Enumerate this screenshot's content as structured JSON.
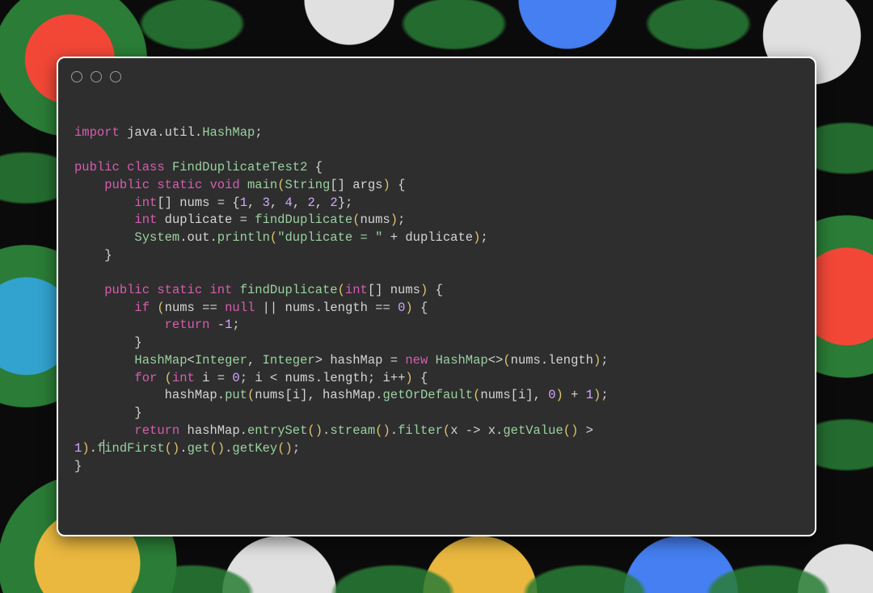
{
  "window": {
    "buttons": [
      "close",
      "minimize",
      "zoom"
    ]
  },
  "code": {
    "line1_import": "import",
    "line1_pkg": "java",
    "line1_dot1": ".",
    "line1_util": "util",
    "line1_dot2": ".",
    "line1_hashmap": "HashMap",
    "line1_semi": ";",
    "l3_public": "public",
    "l3_class": "class",
    "l3_name": "FindDuplicateTest2",
    "l3_brace": " {",
    "l4_indent": "    ",
    "l4_public": "public",
    "l4_static": "static",
    "l4_void": "void",
    "l4_main": "main",
    "l4_po": "(",
    "l4_string": "String",
    "l4_brackets": "[]",
    "l4_sp": " ",
    "l4_args": "args",
    "l4_pc": ")",
    "l4_brace": " {",
    "l5_indent": "        ",
    "l5_int": "int",
    "l5_brackets": "[]",
    "l5_sp": " ",
    "l5_nums": "nums",
    "l5_eq": " = ",
    "l5_bo": "{",
    "l5_v1": "1",
    "l5_c1": ", ",
    "l5_v2": "3",
    "l5_c2": ", ",
    "l5_v3": "4",
    "l5_c3": ", ",
    "l5_v4": "2",
    "l5_c4": ", ",
    "l5_v5": "2",
    "l5_bc": "}",
    "l5_semi": ";",
    "l6_indent": "        ",
    "l6_int": "int",
    "l6_sp": " ",
    "l6_dup": "duplicate",
    "l6_eq": " = ",
    "l6_call": "findDuplicate",
    "l6_po": "(",
    "l6_arg": "nums",
    "l6_pc": ")",
    "l6_semi": ";",
    "l7_indent": "        ",
    "l7_sys": "System",
    "l7_d1": ".",
    "l7_out": "out",
    "l7_d2": ".",
    "l7_println": "println",
    "l7_po": "(",
    "l7_str": "\"duplicate = \"",
    "l7_plus": " + ",
    "l7_dup": "duplicate",
    "l7_pc": ")",
    "l7_semi": ";",
    "l8_indent": "    ",
    "l8_brace": "}",
    "l10_indent": "    ",
    "l10_public": "public",
    "l10_static": "static",
    "l10_int": "int",
    "l10_name": "findDuplicate",
    "l10_po": "(",
    "l10_pint": "int",
    "l10_brk": "[]",
    "l10_sp": " ",
    "l10_nums": "nums",
    "l10_pc": ")",
    "l10_brace": " {",
    "l11_indent": "        ",
    "l11_if": "if",
    "l11_sp": " ",
    "l11_po": "(",
    "l11_nums": "nums",
    "l11_eq": " == ",
    "l11_null": "null",
    "l11_or": " || ",
    "l11_nums2": "nums",
    "l11_d": ".",
    "l11_len": "length",
    "l11_eq2": " == ",
    "l11_zero": "0",
    "l11_pc": ")",
    "l11_brace": " {",
    "l12_indent": "            ",
    "l12_return": "return",
    "l12_sp": " ",
    "l12_neg": "-",
    "l12_one": "1",
    "l12_semi": ";",
    "l13_indent": "        ",
    "l13_brace": "}",
    "l14_indent": "        ",
    "l14_hm": "HashMap",
    "l14_lt": "<",
    "l14_int1": "Integer",
    "l14_c": ", ",
    "l14_int2": "Integer",
    "l14_gt": ">",
    "l14_sp": " ",
    "l14_var": "hashMap",
    "l14_eq": " = ",
    "l14_new": "new",
    "l14_sp2": " ",
    "l14_hm2": "HashMap",
    "l14_diam": "<>",
    "l14_po": "(",
    "l14_nums": "nums",
    "l14_d": ".",
    "l14_len": "length",
    "l14_pc": ")",
    "l14_semi": ";",
    "l15_indent": "        ",
    "l15_for": "for",
    "l15_sp": " ",
    "l15_po": "(",
    "l15_int": "int",
    "l15_sp2": " ",
    "l15_i": "i",
    "l15_eq": " = ",
    "l15_zero": "0",
    "l15_semi1": "; ",
    "l15_i2": "i",
    "l15_lt": " < ",
    "l15_nums": "nums",
    "l15_d": ".",
    "l15_len": "length",
    "l15_semi2": "; ",
    "l15_i3": "i",
    "l15_pp": "++",
    "l15_pc": ")",
    "l15_brace": " {",
    "l16_indent": "            ",
    "l16_hm": "hashMap",
    "l16_d1": ".",
    "l16_put": "put",
    "l16_po": "(",
    "l16_nums": "nums",
    "l16_bo": "[",
    "l16_i": "i",
    "l16_bc": "]",
    "l16_c1": ", ",
    "l16_hm2": "hashMap",
    "l16_d2": ".",
    "l16_god": "getOrDefault",
    "l16_po2": "(",
    "l16_nums2": "nums",
    "l16_bo2": "[",
    "l16_i2": "i",
    "l16_bc2": "]",
    "l16_c2": ", ",
    "l16_zero": "0",
    "l16_pc2": ")",
    "l16_plus": " + ",
    "l16_one": "1",
    "l16_pc": ")",
    "l16_semi": ";",
    "l17_indent": "        ",
    "l17_brace": "}",
    "l18_indent": "        ",
    "l18_return": "return",
    "l18_sp": " ",
    "l18_hm": "hashMap",
    "l18_d1": ".",
    "l18_es": "entrySet",
    "l18_p1": "()",
    "l18_d2": ".",
    "l18_stream": "stream",
    "l18_p2": "()",
    "l18_d3": ".",
    "l18_filter": "filter",
    "l18_po": "(",
    "l18_x": "x",
    "l18_arrow": " -> ",
    "l18_x2": "x",
    "l18_d4": ".",
    "l18_gv": "getValue",
    "l18_p3": "()",
    "l18_gt": " > ",
    "l19_one": "1",
    "l19_pc": ")",
    "l19_d1": ".",
    "l19_f": "f",
    "l19_indFirst": "indFirst",
    "l19_p1": "()",
    "l19_d2": ".",
    "l19_get": "get",
    "l19_p2": "()",
    "l19_d3": ".",
    "l19_gk": "getKey",
    "l19_p3": "()",
    "l19_semi": ";",
    "l20_brace": "}"
  }
}
